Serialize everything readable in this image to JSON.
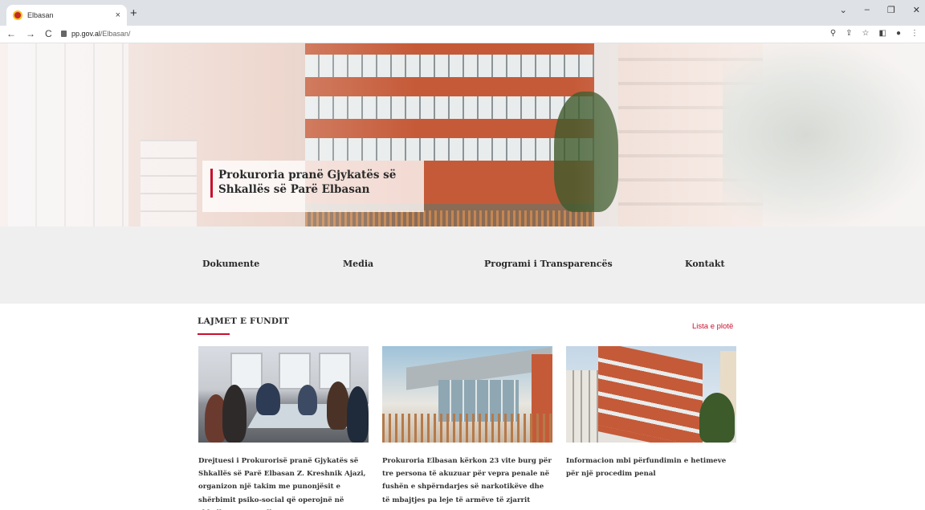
{
  "browser": {
    "tab_title": "Elbasan",
    "tab_close": "×",
    "new_tab": "+",
    "window_controls": {
      "minimize": "–",
      "restore": "❐",
      "close": "✕",
      "chevron": "⌄"
    },
    "nav": {
      "back": "←",
      "forward": "→",
      "reload": "C"
    },
    "url_domain": "pp.gov.al",
    "url_path": "/Elbasan/",
    "addr_icons": {
      "search": "⚲",
      "share": "⇪",
      "bookmark": "☆",
      "sidepanel": "◧",
      "profile": "●",
      "menu": "⋮"
    }
  },
  "hero": {
    "title": "Prokuroria pranë Gjykatës së Shkallës së Parë Elbasan"
  },
  "mainnav": {
    "items": [
      {
        "label": "Dokumente"
      },
      {
        "label": "Media"
      },
      {
        "label": "Programi i Transparencës"
      },
      {
        "label": "Kontakt"
      }
    ]
  },
  "news": {
    "heading": "LAJMET E FUNDIT",
    "all_link": "Lista e plotë",
    "accent_color": "#c8102e",
    "cards": [
      {
        "text": "Drejtuesi i Prokurorisë pranë Gjykatës së Shkallës së Parë Elbasan Z. Kreshnik Ajazi, organizon një takim me punonjësit e shërbimit psiko-social që operojnë në shkollat e ZVAP Elbasan."
      },
      {
        "text": "Prokuroria Elbasan kërkon 23 vite burg për tre persona të akuzuar për vepra penale në fushën e shpërndarjes së narkotikëve dhe të mbajtjes pa leje të armëve të zjarrit"
      },
      {
        "text": "Informacion mbi përfundimin e hetimeve për një procedim penal"
      }
    ]
  }
}
